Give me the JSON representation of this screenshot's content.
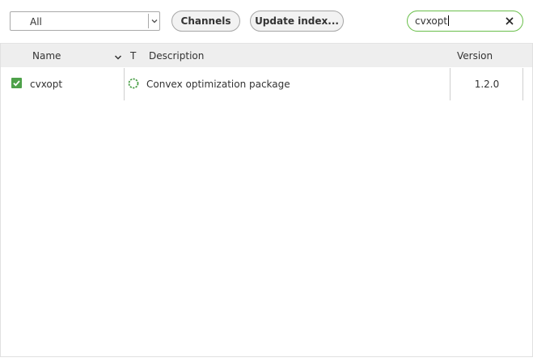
{
  "toolbar": {
    "filter": {
      "selected": "All"
    },
    "channels_label": "Channels",
    "update_index_label": "Update index...",
    "search": {
      "value": "cvxopt"
    }
  },
  "table": {
    "headers": {
      "name": "Name",
      "type": "T",
      "description": "Description",
      "version": "Version"
    },
    "rows": [
      {
        "checked": true,
        "name": "cvxopt",
        "type_icon": "loading-spinner-icon",
        "description": "Convex optimization package",
        "version": "1.2.0"
      }
    ]
  },
  "colors": {
    "accent_green": "#4ea14a",
    "search_border": "#6abf4b",
    "header_bg": "#eeeeee",
    "button_bg": "#f2f2f2"
  },
  "icons": {
    "filter_dropdown": "chevron-down-icon",
    "search_clear": "close-icon",
    "sort_indicator": "chevron-down-icon",
    "row_checkbox": "checkmark-icon"
  }
}
